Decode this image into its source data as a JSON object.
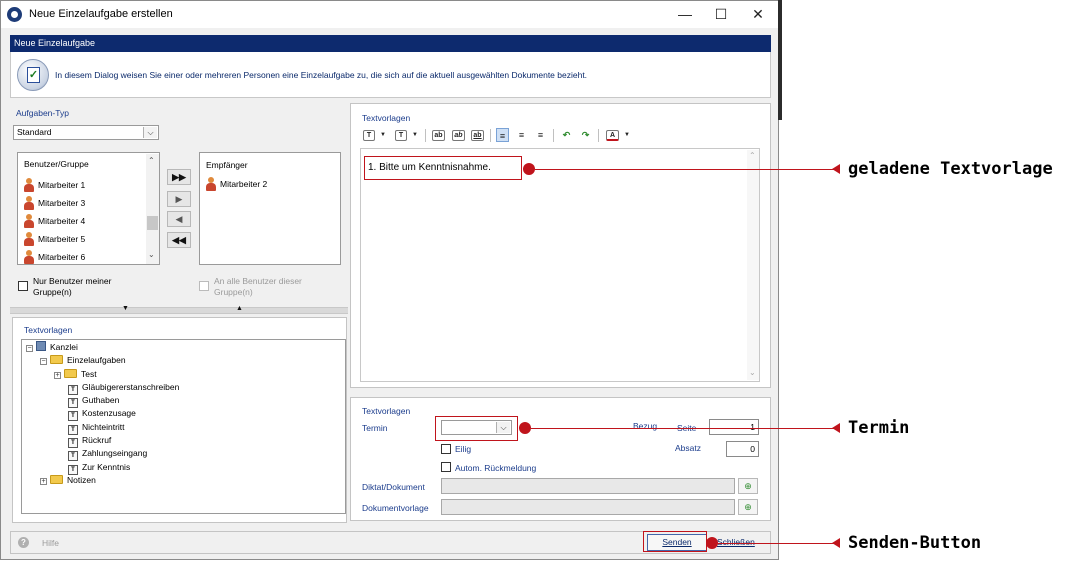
{
  "window": {
    "title": "Neue Einzelaufgabe erstellen",
    "minimize_glyph": "—",
    "maximize_glyph": "☐",
    "close_glyph": "✕"
  },
  "banner": {
    "title": "Neue Einzelaufgabe"
  },
  "info": {
    "text": "In diesem Dialog weisen Sie einer oder mehreren Personen eine Einzelaufgabe zu, die sich auf die aktuell ausgewählten Dokumente bezieht.",
    "icon": "task-check-icon"
  },
  "aufgaben_typ": {
    "label": "Aufgaben-Typ",
    "value": "Standard"
  },
  "benutzer": {
    "header": "Benutzer/Gruppe",
    "items": [
      "Mitarbeiter 1",
      "Mitarbeiter 3",
      "Mitarbeiter 4",
      "Mitarbeiter 5",
      "Mitarbeiter 6"
    ]
  },
  "move_buttons": [
    "▶▶",
    "▶",
    "◀",
    "◀◀"
  ],
  "empfaenger": {
    "header": "Empfänger",
    "items": [
      "Mitarbeiter 2"
    ]
  },
  "checkboxes": {
    "nur_benutzer": "Nur Benutzer meiner Gruppe(n)",
    "an_alle": "An alle Benutzer dieser Gruppe(n)"
  },
  "tree": {
    "label": "Textvorlagen",
    "nodes": {
      "kanzlei": "Kanzlei",
      "einzelaufgaben": "Einzelaufgaben",
      "test": "Test",
      "items": [
        "Gläubigererstanschreiben",
        "Guthaben",
        "Kostenzusage",
        "Nichteintritt",
        "Rückruf",
        "Zahlungseingang",
        "Zur Kenntnis"
      ],
      "notizen": "Notizen"
    }
  },
  "editor": {
    "label": "Textvorlagen",
    "content": "1. Bitte um Kenntnisnahme.",
    "toolbar": [
      "T",
      "T",
      "ab",
      "ab",
      "ab",
      "align-left",
      "align-center",
      "align-right",
      "undo",
      "redo",
      "A"
    ]
  },
  "form": {
    "section_label": "Textvorlagen",
    "termin_label": "Termin",
    "termin_value": "",
    "bezug_label": "Bezug",
    "seite_label": "Seite",
    "seite_value": "1",
    "absatz_label": "Absatz",
    "absatz_value": "0",
    "eilig_label": "Eilig",
    "autom_label": "Autom. Rückmeldung",
    "diktat_label": "Diktat/Dokument",
    "dokvorlage_label": "Dokumentvorlage"
  },
  "footer": {
    "hilfe": "Hilfe",
    "senden": "Senden",
    "schliessen": "Schließen"
  },
  "callouts": {
    "textvorlage": "geladene Textvorlage",
    "termin": "Termin",
    "senden": "Senden-Button"
  },
  "colors": {
    "banner": "#0d2a6e",
    "annotation_red": "#c0141c",
    "label_blue": "#1b3c8c"
  }
}
